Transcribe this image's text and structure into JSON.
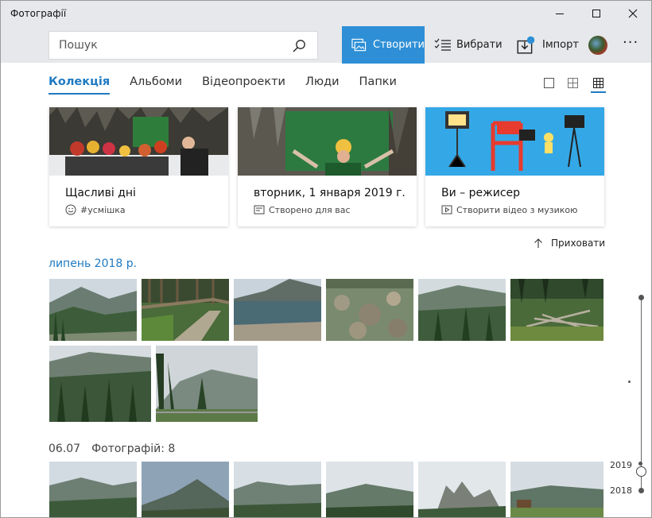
{
  "window": {
    "title": "Фотографії"
  },
  "header": {
    "search_placeholder": "Пошук",
    "create_label": "Створити",
    "select_label": "Вибрати",
    "import_label": "Імпорт",
    "more_label": "···"
  },
  "tabs": [
    {
      "label": "Колекція",
      "active": true
    },
    {
      "label": "Альбоми",
      "active": false
    },
    {
      "label": "Відеопроекти",
      "active": false
    },
    {
      "label": "Люди",
      "active": false
    },
    {
      "label": "Папки",
      "active": false
    }
  ],
  "cards": [
    {
      "title": "Щасливі дні",
      "subtitle": "#усмішка",
      "icon": "smiley-icon"
    },
    {
      "title": "вторник, 1 января 2019 г.",
      "subtitle": "Створено для вас",
      "icon": "album-icon"
    },
    {
      "title": "Ви – режисер",
      "subtitle": "Створити відео з музикою",
      "icon": "video-icon"
    }
  ],
  "hide_label": "Приховати",
  "month_label": "липень 2018 р.",
  "date_group": {
    "date": "06.07",
    "count": "Фотографій: 8"
  },
  "timeline": {
    "years": [
      "2019",
      "2018"
    ]
  },
  "colors": {
    "accent": "#2e8fd6",
    "link": "#1f7ac2"
  }
}
